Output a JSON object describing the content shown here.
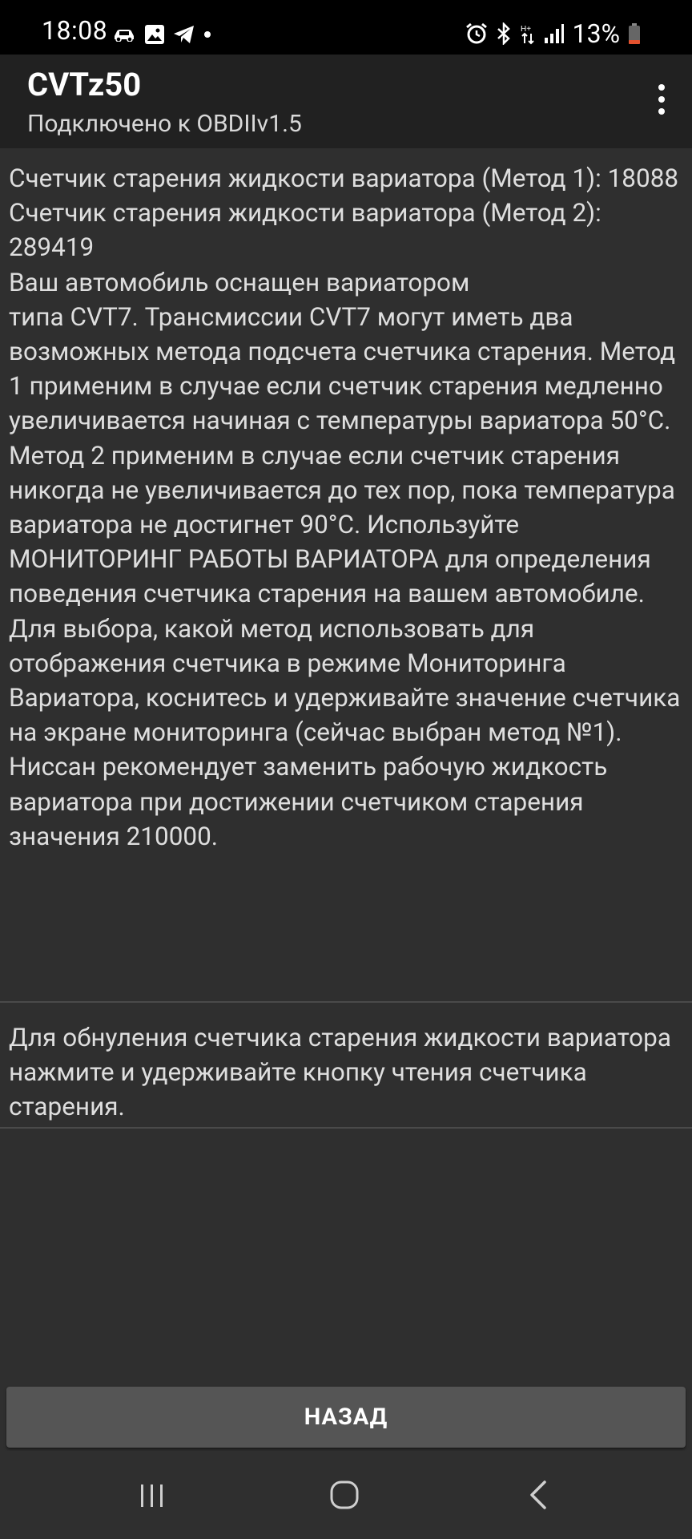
{
  "status_bar": {
    "time": "18:08",
    "battery": "13%",
    "left_icons": [
      "car-icon",
      "image-icon",
      "telegram-icon",
      "dot-icon"
    ],
    "right_icons": [
      "alarm-icon",
      "bluetooth-icon",
      "data-icon",
      "signal-icon",
      "battery-icon"
    ],
    "battery_color": "#e4522f"
  },
  "app_bar": {
    "title": "CVTz50",
    "subtitle": "Подключено к OBDIIv1.5",
    "background": "#212121"
  },
  "content": {
    "block1": "Счетчик старения жидкости вариатора (Метод 1): 18088\nСчетчик старения жидкости вариатора (Метод 2): 289419\nВаш автомобиль оснащен вариатором\nтипа CVT7. Трансмиссии CVT7 могут иметь два возможных метода подсчета счетчика старения. Метод 1 применим в случае если счетчик старения медленно увеличивается начиная с температуры вариатора 50°C. Метод 2 применим в случае если счетчик старения никогда не увеличивается до тех пор, пока температура вариатора не достигнет 90°C. Используйте МОНИТОРИНГ РАБОТЫ ВАРИАТОРА для определения поведения счетчика старения на вашем автомобиле. Для выбора, какой метод использовать для отображения счетчика в режиме Мониторинга Вариатора, коснитесь и удерживайте значение счетчика на экране мониторинга (сейчас выбран метод №1).  Ниссан рекомендует заменить рабочую жидкость вариатора при достижении счетчиком старения значения 210000.",
    "block2": "Для обнуления счетчика старения жидкости вариатора нажмите и удерживайте кнопку чтения счетчика старения."
  },
  "back_button": {
    "label": "НАЗАД"
  },
  "nav_bar": {
    "icons": [
      "recent-apps-icon",
      "home-icon",
      "back-icon"
    ]
  }
}
